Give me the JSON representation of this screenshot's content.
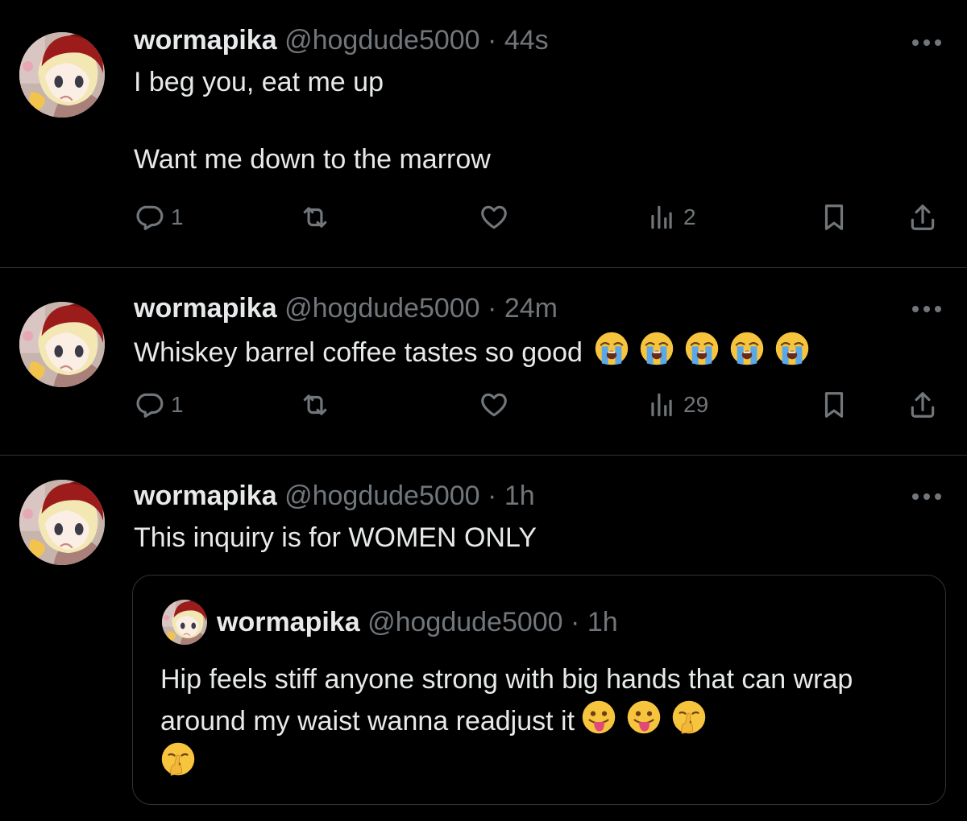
{
  "tweets": [
    {
      "name": "wormapika",
      "handle": "@hogdude5000",
      "separator": "·",
      "time": "44s",
      "text": "I beg you, eat me up\n\nWant me down to the marrow",
      "replies": "1",
      "views": "2"
    },
    {
      "name": "wormapika",
      "handle": "@hogdude5000",
      "separator": "·",
      "time": "24m",
      "text": "Whiskey barrel coffee tastes so good",
      "emojis": [
        "loudly-crying-face",
        "loudly-crying-face",
        "loudly-crying-face",
        "loudly-crying-face",
        "loudly-crying-face"
      ],
      "replies": "1",
      "views": "29"
    },
    {
      "name": "wormapika",
      "handle": "@hogdude5000",
      "separator": "·",
      "time": "1h",
      "text": "This inquiry is for WOMEN ONLY",
      "quote": {
        "name": "wormapika",
        "handle": "@hogdude5000",
        "separator": "·",
        "time": "1h",
        "text": "Hip feels stiff anyone strong with big hands that can wrap around my waist wanna readjust it",
        "emojis": [
          "face-with-tongue",
          "face-with-tongue",
          "shushing-face",
          "shushing-face"
        ]
      }
    }
  ],
  "icons": {
    "reply": "reply-icon",
    "retweet": "retweet-icon",
    "like": "heart-icon",
    "views": "views-icon",
    "bookmark": "bookmark-icon",
    "share": "share-icon",
    "more": "more-icon"
  },
  "colors": {
    "background": "#000000",
    "text": "#e7e9ea",
    "secondary": "#71767b",
    "divider": "#2f3336"
  }
}
